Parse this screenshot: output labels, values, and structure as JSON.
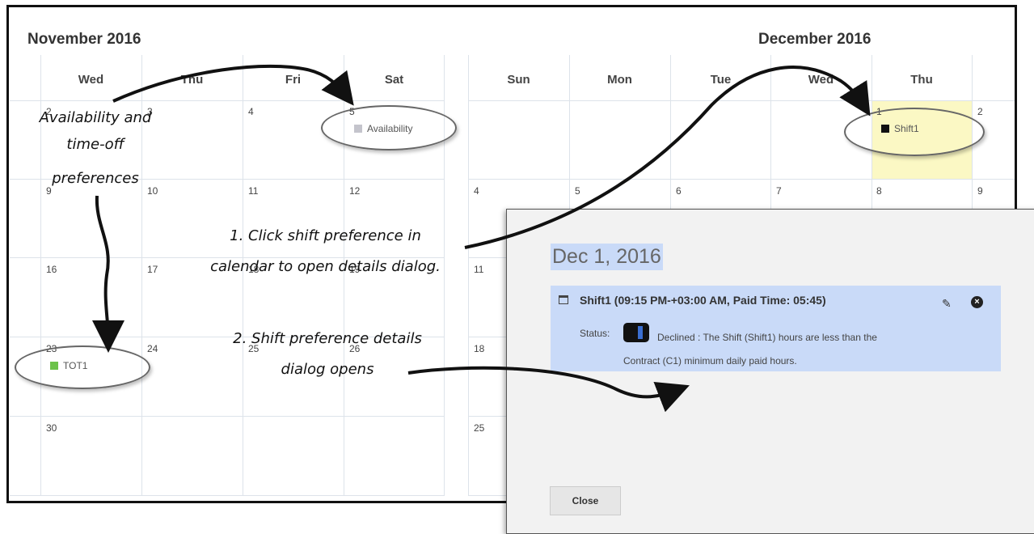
{
  "november": {
    "title": "November 2016",
    "weekdays": [
      "Wed",
      "Thu",
      "Fri",
      "Sat"
    ],
    "days": [
      "2",
      "3",
      "4",
      "5",
      "9",
      "10",
      "11",
      "12",
      "16",
      "17",
      "18",
      "19",
      "23",
      "24",
      "25",
      "26",
      "30"
    ],
    "events": {
      "sat5": "Availability",
      "wed23": "TOT1"
    }
  },
  "december": {
    "title": "December 2016",
    "weekdays": [
      "Sun",
      "Mon",
      "Tue",
      "Wed",
      "Thu"
    ],
    "days": [
      "1",
      "2",
      "4",
      "5",
      "6",
      "7",
      "8",
      "9",
      "11",
      "18",
      "25"
    ],
    "events": {
      "thu1": "Shift1"
    }
  },
  "annotations": {
    "pref_line1": "Availability and",
    "pref_line2": "time-off",
    "pref_line3": "preferences",
    "step1_line1": "1. Click shift preference in",
    "step1_line2": "calendar to open details dialog.",
    "step2_line1": "2. Shift preference details",
    "step2_line2": "dialog opens"
  },
  "dialog": {
    "title": "Dec 1, 2016",
    "pref_header": "Shift1 (09:15 PM-+03:00 AM, Paid Time: 05:45)",
    "status_label": "Status:",
    "status_text": "Declined : The Shift (Shift1) hours are less than the Contract (C1) minimum daily paid hours.",
    "close_label": "Close"
  },
  "colors": {
    "availability": "#c4c4cc",
    "tot": "#6cc24a",
    "shift": "#111111",
    "highlight": "#fbf8c4",
    "selection": "#c9daf8"
  },
  "icons": [
    "calendar-icon",
    "pencil-icon",
    "close-circle-icon",
    "status-icon"
  ]
}
